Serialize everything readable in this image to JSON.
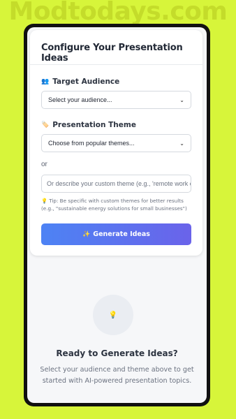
{
  "watermark": "Modtodays.com",
  "card": {
    "title": "Configure Your Presentation Ideas",
    "audience": {
      "icon": "people-icon",
      "label": "Target Audience",
      "select_value": "Select your audience..."
    },
    "theme": {
      "icon": "tag-icon",
      "label": "Presentation Theme",
      "select_value": "Choose from popular themes..."
    },
    "or_text": "or",
    "custom_theme_placeholder": "Or describe your custom theme (e.g., 'remote work c",
    "tip": "Tip: Be specific with custom themes for better results (e.g., \"sustainable energy solutions for small businesses\")",
    "tip_icon": "lightbulb-icon",
    "generate_button": {
      "icon": "sparkles-icon",
      "label": "Generate Ideas"
    }
  },
  "empty_state": {
    "icon": "lightbulb-icon",
    "title": "Ready to Generate Ideas?",
    "description": "Select your audience and theme above to get started with AI-powered presentation topics."
  }
}
